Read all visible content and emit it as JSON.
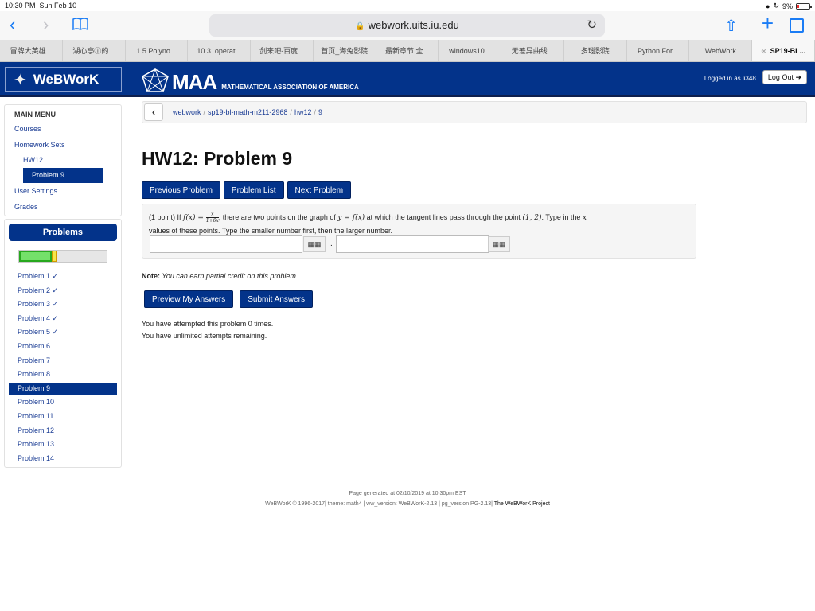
{
  "status": {
    "time": "10:30 PM",
    "date": "Sun Feb 10",
    "battery": "9%"
  },
  "browser": {
    "url": "webwork.uits.iu.edu",
    "tabs": [
      {
        "label": "冒牌大英雄..."
      },
      {
        "label": "湖心亭ⓘ的..."
      },
      {
        "label": "1.5 Polyno..."
      },
      {
        "label": "10.3. operat..."
      },
      {
        "label": "剑来吧-百度..."
      },
      {
        "label": "首页_海兔影院"
      },
      {
        "label": "最新章节 全..."
      },
      {
        "label": "windows10..."
      },
      {
        "label": "无差异曲线..."
      },
      {
        "label": "多瑙影院"
      },
      {
        "label": "Python For..."
      },
      {
        "label": "WebWork"
      },
      {
        "label": "SP19-BL..."
      }
    ]
  },
  "header": {
    "logo": "WeBWorK",
    "maa_big": "MAA",
    "maa_small": "MATHEMATICAL ASSOCIATION OF AMERICA",
    "logged_in": "Logged in as li348.",
    "logout": "Log Out"
  },
  "sidebar": {
    "title": "MAIN MENU",
    "courses": "Courses",
    "homework_sets": "Homework Sets",
    "hw12": "HW12",
    "problem9": "Problem 9",
    "user_settings": "User Settings",
    "grades": "Grades"
  },
  "problems_panel": {
    "title": "Problems",
    "progress_fraction": 0.37,
    "items": [
      "Problem 1 ✓",
      "Problem 2 ✓",
      "Problem 3 ✓",
      "Problem 4 ✓",
      "Problem 5 ✓",
      "Problem 6 ...",
      "Problem 7",
      "Problem 8",
      "Problem 9",
      "Problem 10",
      "Problem 11",
      "Problem 12",
      "Problem 13",
      "Problem 14"
    ]
  },
  "breadcrumb": {
    "items": [
      "webwork",
      "sp19-bl-math-m211-2968",
      "hw12",
      "9"
    ]
  },
  "page": {
    "title": "HW12: Problem 9",
    "prev": "Previous Problem",
    "list": "Problem List",
    "next": "Next Problem"
  },
  "problem": {
    "points": "(1 point) If ",
    "fx": "f(x) = ",
    "frac_num": "x",
    "frac_den": "1+6x",
    "text1": ", there are two points on the graph of ",
    "yfx": "y = f(x)",
    "text2": " at which the tangent lines pass through the point ",
    "point": "(1, 2)",
    "text3": ". Type in the ",
    "xvar": "x",
    "text4": "values of these points. Type the smaller number first, then the larger number.",
    "answer1": "",
    "answer2": "",
    "separator": "."
  },
  "note": {
    "label": "Note:",
    "text": " You can earn partial credit on this problem."
  },
  "submit": {
    "preview": "Preview My Answers",
    "submit": "Submit Answers"
  },
  "attempts": {
    "line1": "You have attempted this problem 0 times.",
    "line2": "You have unlimited attempts remaining."
  },
  "footer": {
    "generated": "Page generated at 02/10/2019 at 10:30pm EST",
    "version": "WeBWorK © 1996-2017| theme: math4 | ww_version: WeBWorK-2.13 | pg_version PG-2.13|",
    "project": "The WeBWorK Project"
  },
  "colors": {
    "brand": "#03338a",
    "link": "#1a3c94",
    "safari_blue": "#1a7cf5"
  }
}
